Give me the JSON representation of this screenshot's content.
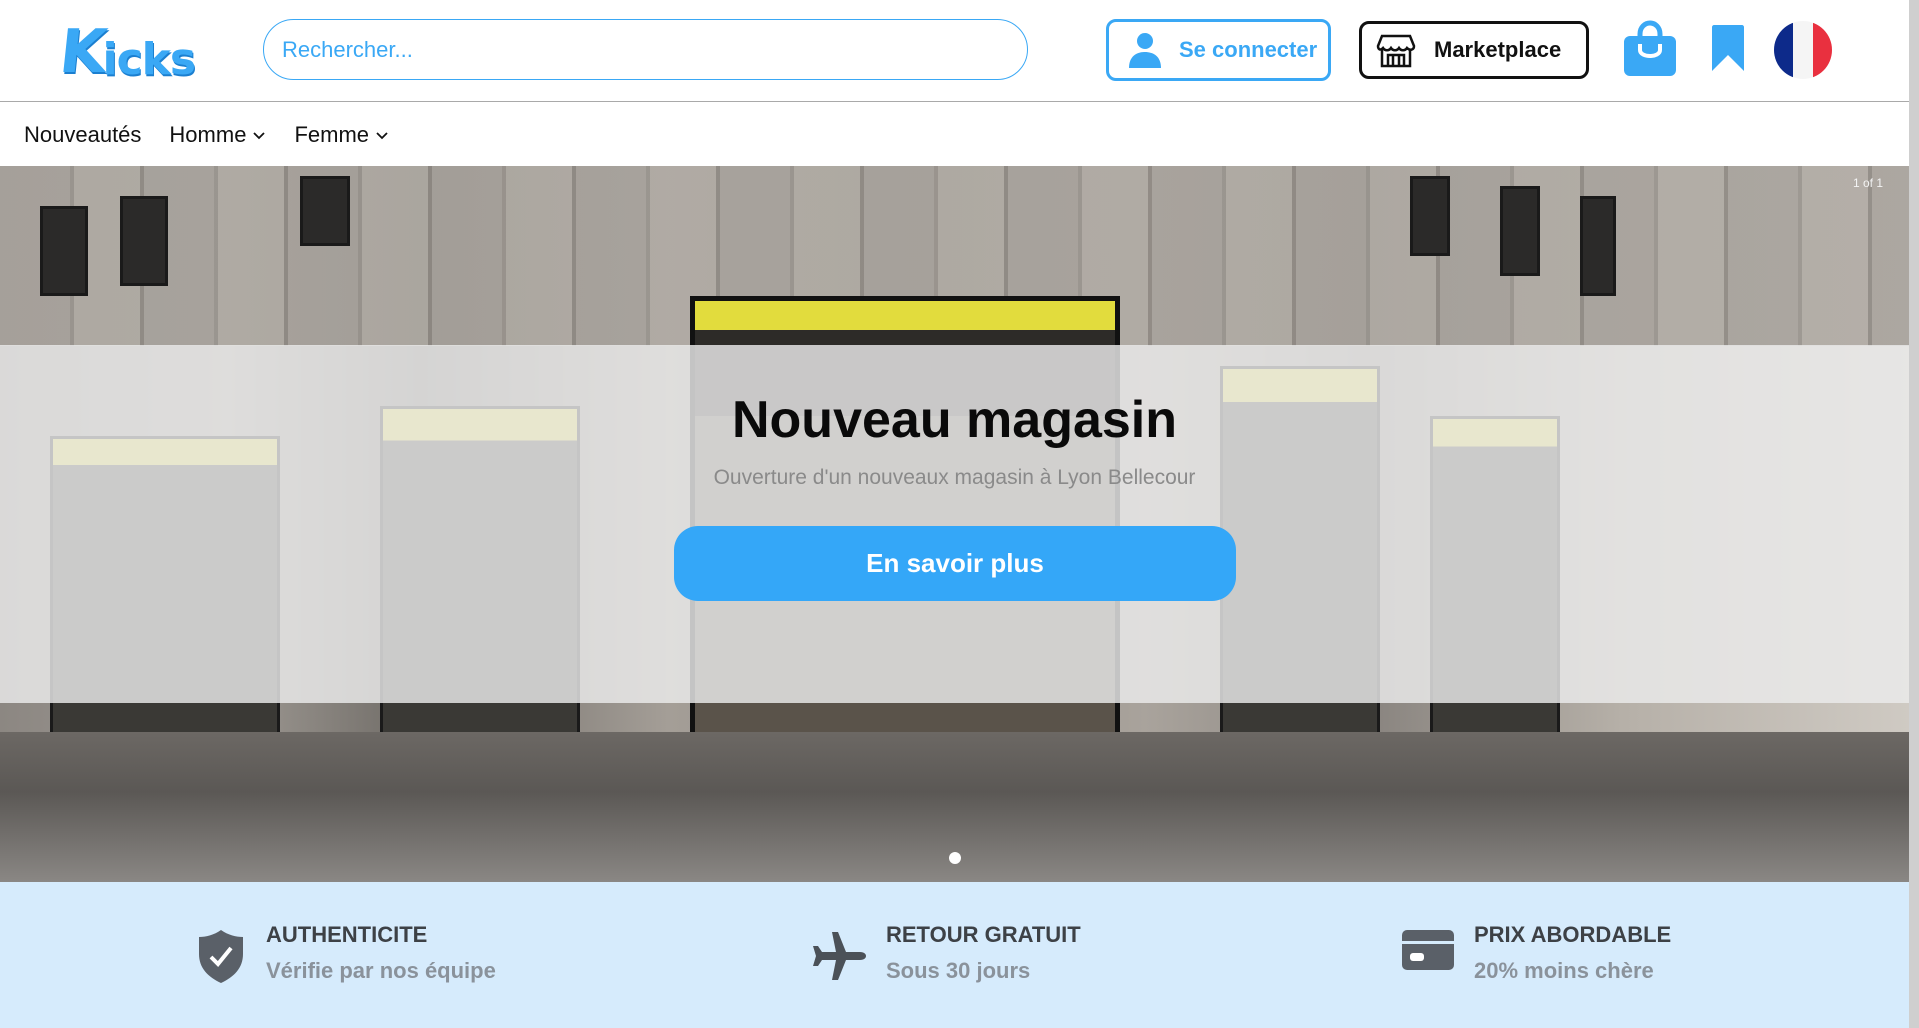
{
  "header": {
    "logo": {
      "first": "K",
      "rest": "icks"
    },
    "search": {
      "placeholder": "Rechercher..."
    },
    "login_label": "Se connecter",
    "marketplace_label": "Marketplace",
    "icons": [
      "user-icon",
      "store-icon",
      "shopping-bag-icon",
      "bookmark-icon",
      "french-flag-icon"
    ]
  },
  "nav": {
    "items": [
      {
        "label": "Nouveautés",
        "has_dropdown": false
      },
      {
        "label": "Homme",
        "has_dropdown": true
      },
      {
        "label": "Femme",
        "has_dropdown": true
      }
    ]
  },
  "hero": {
    "counter": "1 of 1",
    "title": "Nouveau magasin",
    "subtitle": "Ouverture d'un nouveaux magasin à Lyon Bellecour",
    "cta_label": "En savoir plus",
    "slides_total": 1,
    "active_slide": 1
  },
  "features": [
    {
      "icon": "shield-check-icon",
      "title": "AUTHENTICITE",
      "subtitle": "Vérifie par nos équipe"
    },
    {
      "icon": "airplane-icon",
      "title": "RETOUR GRATUIT",
      "subtitle": "Sous 30 jours"
    },
    {
      "icon": "credit-card-icon",
      "title": "PRIX ABORDABLE",
      "subtitle": "20% moins chère"
    }
  ],
  "colors": {
    "accent": "#34a7f8",
    "features_bg": "#d6ebfc",
    "feature_title": "#3d4146",
    "feature_subtitle": "#8a929b"
  }
}
